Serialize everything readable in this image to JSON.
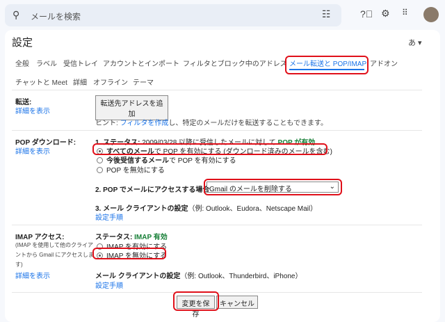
{
  "search": {
    "placeholder": "メールを検索"
  },
  "header": {
    "title": "設定",
    "lang": "あ ▾"
  },
  "tabs": [
    "全般",
    "ラベル",
    "受信トレイ",
    "アカウントとインポート",
    "フィルタとブロック中のアドレス",
    "メール転送と POP/IMAP",
    "アドオン",
    "チャットと Meet",
    "詳細",
    "オフライン",
    "テーマ"
  ],
  "forwarding": {
    "label": "転送:",
    "details": "詳細を表示",
    "add_button": "転送先アドレスを追加",
    "hint_prefix": "ヒント: ",
    "hint_link": "フィルタを作成",
    "hint_suffix": "し、特定のメールだけを転送することもできます。"
  },
  "pop": {
    "label": "POP ダウンロード:",
    "details": "詳細を表示",
    "status_label": "1. ステータス:",
    "status_text": " 2009/03/28 以降に受信したメールに対して ",
    "status_value": "POP が有効",
    "opt1_bold": "すべてのメール",
    "opt1_rest": "で POP を有効にする (ダウンロード済みのメールを含む)",
    "opt2_bold": "今後受信するメール",
    "opt2_rest": "で POP を有効にする",
    "opt3": "POP を無効にする",
    "access_label": "2. POP でメールにアクセスする場合",
    "access_value": "Gmail のメールを削除する",
    "client_label": "3. メール クライアントの設定",
    "client_examples": "（例: Outlook、Eudora、Netscape Mail）",
    "setup_link": "設定手順"
  },
  "imap": {
    "label": "IMAP アクセス:",
    "desc1": "(IMAP を使用して他のクライア",
    "desc2": "ントから Gmail にアクセスしま",
    "desc3": "す)",
    "details": "詳細を表示",
    "status_label": "ステータス: ",
    "status_value": "IMAP 有効",
    "opt1": "IMAP を有効にする",
    "opt2": "IMAP を無効にする",
    "client_label": "メール クライアントの設定",
    "client_examples": "（例: Outlook、Thunderbird、iPhone）",
    "setup_link": "設定手順"
  },
  "footer": {
    "save": "変更を保存",
    "cancel": "キャンセル"
  }
}
